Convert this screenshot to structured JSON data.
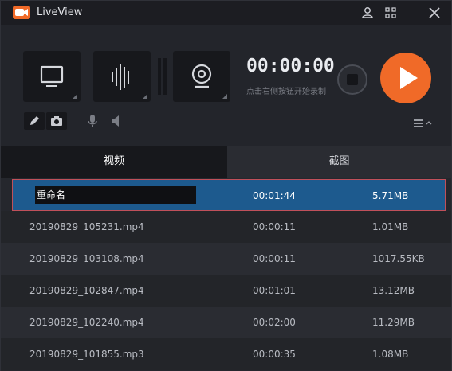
{
  "app": {
    "title": "LiveView",
    "colors": {
      "accent": "#f06a28",
      "selected_row": "#1d5a8e",
      "background": "#22242a"
    },
    "icons": {
      "logo": "camera-logo-icon",
      "user": "user-icon",
      "menu": "grid-menu-icon",
      "close": "close-icon"
    }
  },
  "controls": {
    "sources": [
      {
        "name": "screen",
        "icon": "monitor-icon"
      },
      {
        "name": "audio",
        "icon": "waveform-icon"
      },
      {
        "name": "camera",
        "icon": "webcam-icon"
      }
    ],
    "timer": "00:00:00",
    "hint": "点击右侧按钮开始录制",
    "tools": [
      "pen-icon",
      "camera-snapshot-icon",
      "microphone-icon",
      "speaker-icon",
      "list-menu-icon"
    ]
  },
  "tabs": [
    {
      "label": "视频",
      "active": true
    },
    {
      "label": "截图",
      "active": false
    }
  ],
  "files": [
    {
      "name": "重命名",
      "duration": "00:01:44",
      "size": "5.71MB",
      "selected": true,
      "editing": true
    },
    {
      "name": "20190829_105231.mp4",
      "duration": "00:00:11",
      "size": "1.01MB"
    },
    {
      "name": "20190829_103108.mp4",
      "duration": "00:00:11",
      "size": "1017.55KB"
    },
    {
      "name": "20190829_102847.mp4",
      "duration": "00:01:01",
      "size": "13.12MB"
    },
    {
      "name": "20190829_102240.mp4",
      "duration": "00:02:00",
      "size": "11.29MB"
    },
    {
      "name": "20190829_101855.mp3",
      "duration": "00:00:35",
      "size": "1.08MB"
    }
  ]
}
